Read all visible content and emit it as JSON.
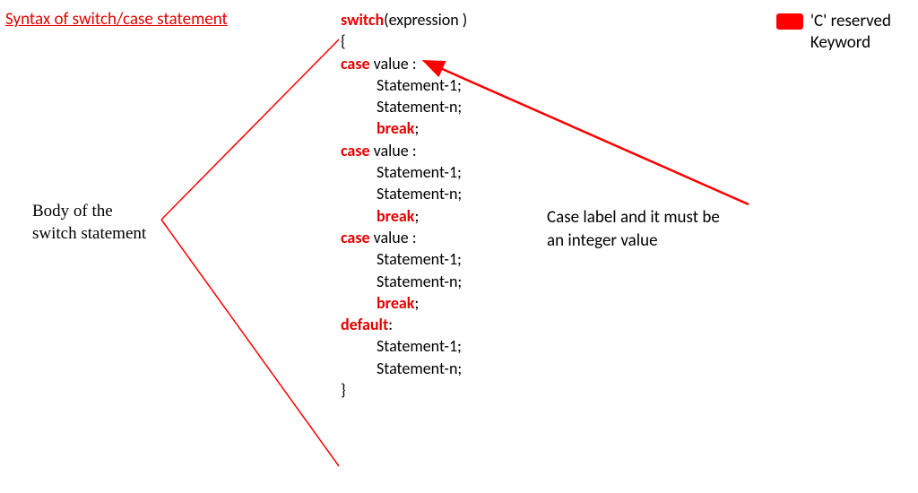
{
  "title": "Syntax of switch/case statement",
  "legend": {
    "line1": "'C' reserved",
    "line2": "Keyword"
  },
  "body_label": {
    "line1": "Body of the",
    "line2": "switch statement"
  },
  "case_label": {
    "line1": "Case label and it must be",
    "line2": "an integer value"
  },
  "code": {
    "kw_switch": "switch",
    "expr": "(expression )",
    "brace_open": "{",
    "kw_case": "case",
    "value_colon1": " value :",
    "value_colon2": " value :",
    "value_colon3": " value :",
    "stmt1": "Statement-1;",
    "stmtn": "Statement-n;",
    "kw_break": "break",
    "semicolon": ";",
    "kw_default": "default",
    "colon": ":",
    "brace_close": "}"
  }
}
